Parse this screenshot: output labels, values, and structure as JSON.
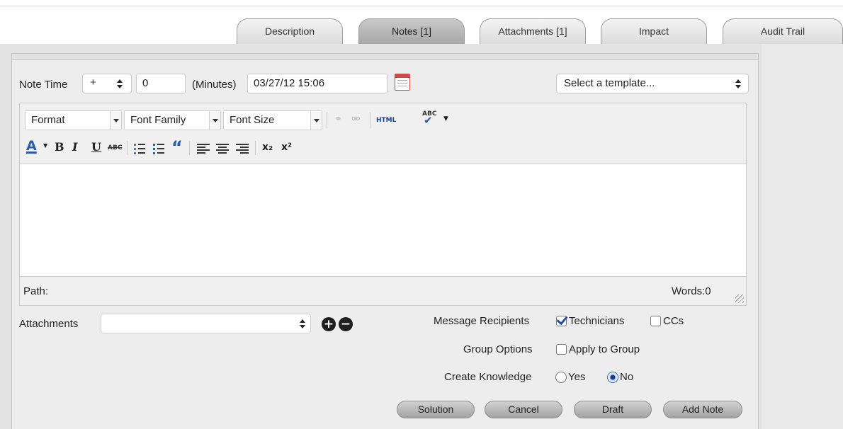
{
  "tabs": [
    {
      "label": "Description"
    },
    {
      "label": "Notes [1]"
    },
    {
      "label": "Attachments [1]"
    },
    {
      "label": "Impact"
    },
    {
      "label": "Audit Trail"
    }
  ],
  "active_tab": "Notes [1]",
  "note_time": {
    "label": "Note Time",
    "sign": "+",
    "minutes_value": "0",
    "minutes_unit": "(Minutes)",
    "datetime": "03/27/12 15:06"
  },
  "template": {
    "selected": "Select a template..."
  },
  "editor": {
    "format_label": "Format",
    "font_family_label": "Font Family",
    "font_size_label": "Font Size",
    "html_label": "HTML",
    "spellcheck_label": "ABC",
    "font_color_label": "A",
    "bold_label": "B",
    "italic_label": "I",
    "underline_label": "U",
    "strike_label": "ABC",
    "blockquote_label": "“",
    "subscript_label": "x₂",
    "superscript_label": "x²",
    "path_label": "Path:",
    "words_label": "Words:0"
  },
  "attachments": {
    "label": "Attachments"
  },
  "message_recipients": {
    "label": "Message Recipients",
    "technicians_label": "Technicians",
    "technicians_checked": true,
    "ccs_label": "CCs",
    "ccs_checked": false
  },
  "group_options": {
    "label": "Group Options",
    "apply_label": "Apply to Group",
    "checked": false
  },
  "create_knowledge": {
    "label": "Create Knowledge",
    "yes_label": "Yes",
    "no_label": "No",
    "selected": "No"
  },
  "buttons": {
    "solution": "Solution",
    "cancel": "Cancel",
    "draft": "Draft",
    "add_note": "Add Note"
  },
  "colors": {
    "active_tab": "#a7a7a7",
    "panel_bg": "#ededed",
    "check_accent": "#2a4f9c"
  }
}
